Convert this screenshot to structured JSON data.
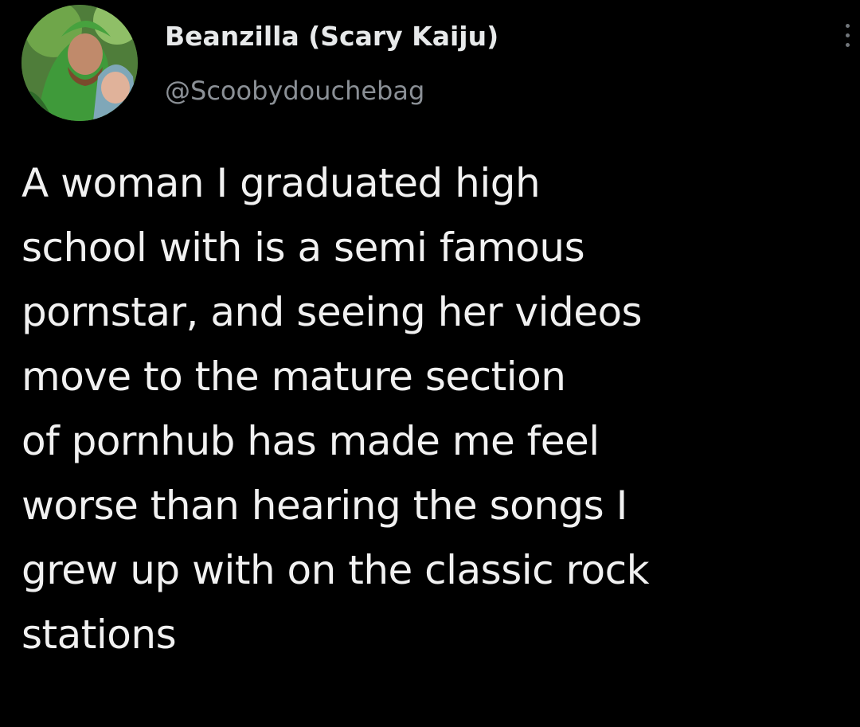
{
  "author": {
    "display_name": "Beanzilla (Scary Kaiju)",
    "handle": "@Scoobydouchebag",
    "avatar_icon": "user-avatar"
  },
  "menu": {
    "icon": "more-options-icon"
  },
  "tweet": {
    "lines": [
      "A woman I graduated high",
      "school with is a semi famous",
      "pornstar, and seeing her videos",
      "move to the mature section",
      "of pornhub has made me feel",
      "worse than hearing the songs I",
      "grew up with on the classic rock",
      "stations"
    ]
  },
  "colors": {
    "background": "#000000",
    "text": "#e7e9ea",
    "secondary_text": "#8b9096"
  }
}
